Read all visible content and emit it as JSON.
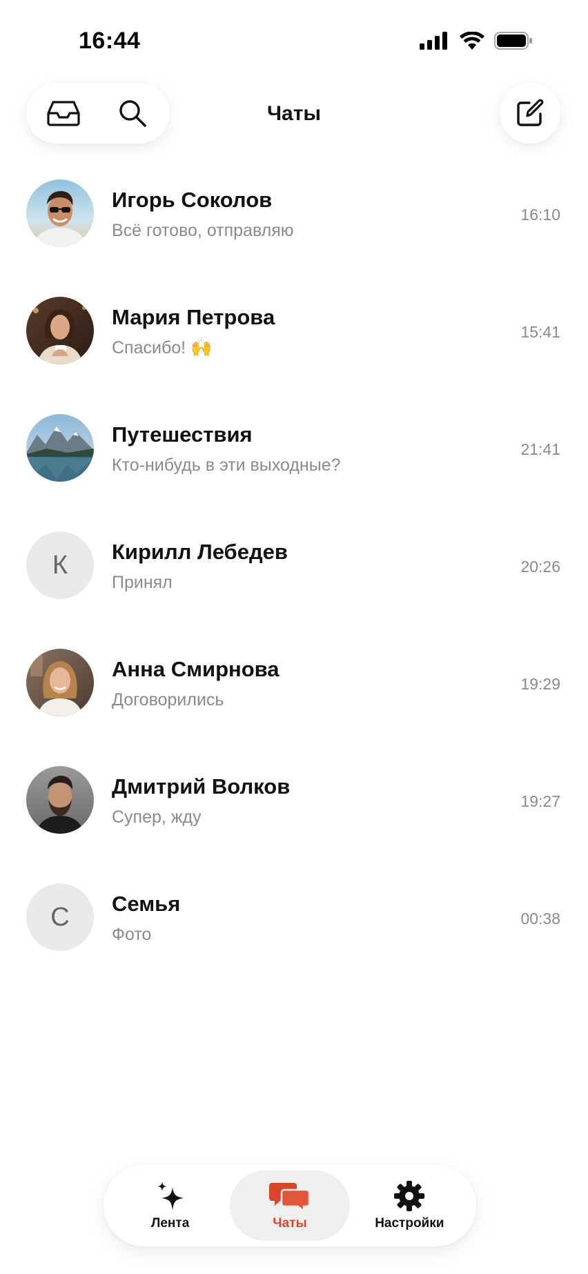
{
  "status_bar": {
    "time": "16:44",
    "icons": [
      "cellular-signal-icon",
      "wifi-icon",
      "battery-icon"
    ]
  },
  "header": {
    "title": "Чаты",
    "left_icons": [
      "inbox-icon",
      "search-icon"
    ],
    "right_icon": "compose-icon"
  },
  "chats": [
    {
      "name": "Игорь Соколов",
      "preview": "Всё готово, отправляю",
      "time": "16:10",
      "avatar": "photo",
      "avatar_theme": "man-sunglasses-beach"
    },
    {
      "name": "Мария Петрова",
      "preview": "Спасибо! 🙌",
      "time": "15:41",
      "avatar": "photo",
      "avatar_theme": "woman-coffee"
    },
    {
      "name": "Путешествия",
      "preview": "Кто-нибудь в эти выходные?",
      "time": "21:41",
      "avatar": "photo",
      "avatar_theme": "mountain-lake"
    },
    {
      "name": "Кирилл Лебедев",
      "preview": "Принял",
      "time": "20:26",
      "avatar": "letter",
      "letter": "К"
    },
    {
      "name": "Анна Смирнова",
      "preview": "Договорились",
      "time": "19:29",
      "avatar": "photo",
      "avatar_theme": "woman-cafe"
    },
    {
      "name": "Дмитрий Волков",
      "preview": "Супер, жду",
      "time": "19:27",
      "avatar": "photo",
      "avatar_theme": "bearded-man"
    },
    {
      "name": "Семья",
      "preview": "Фото",
      "time": "00:38",
      "avatar": "letter",
      "letter": "С"
    }
  ],
  "tabs": [
    {
      "label": "Лента",
      "icon": "sparkles-icon",
      "active": false
    },
    {
      "label": "Чаты",
      "icon": "chat-bubbles-icon",
      "active": true
    },
    {
      "label": "Настройки",
      "icon": "gear-icon",
      "active": false
    }
  ],
  "colors": {
    "accent": "#d9472b",
    "text_primary": "#111111",
    "text_secondary": "#8a8a8a",
    "avatar_placeholder": "#e9e9e9",
    "active_tab_bg": "#efefef"
  }
}
